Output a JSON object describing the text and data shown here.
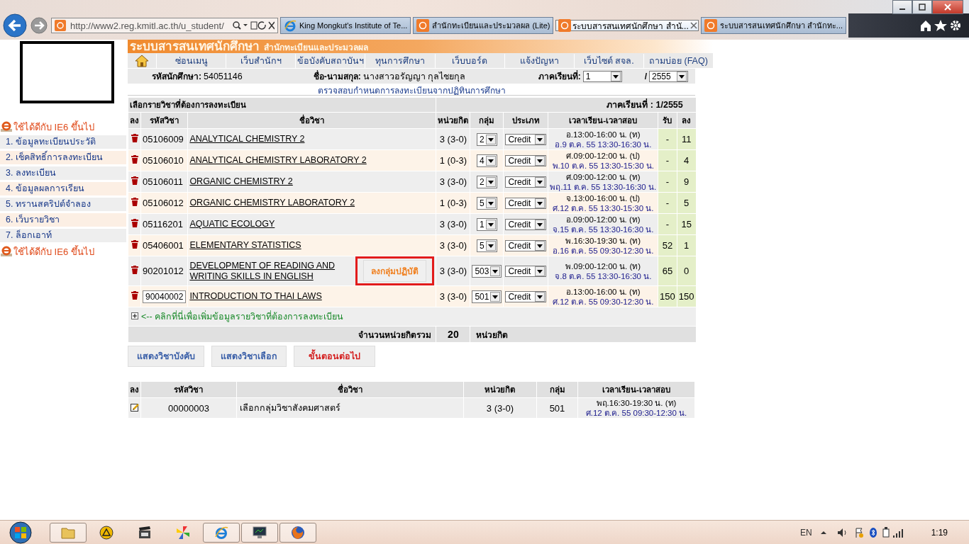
{
  "browser": {
    "url": "http://www2.reg.kmitl.ac.th/u_student/",
    "tabs": [
      {
        "title": "King Mongkut's Institute of Te...",
        "kind": "ie",
        "selected": false
      },
      {
        "title": "สำนักทะเบียนและประมวลผล (Lite)",
        "kind": "reg",
        "selected": false
      },
      {
        "title": "ระบบสารสนเทศนักศึกษา สำนั...",
        "kind": "reg",
        "selected": true
      },
      {
        "title": "ระบบสารสนเทศนักศึกษา สำนักทะ...",
        "kind": "reg",
        "selected": false
      }
    ]
  },
  "sidebar": {
    "note_top": "ใช้ได้ดีกับ IE6 ขึ้นไป",
    "items": [
      "1. ข้อมูลทะเบียนประวัติ",
      "2. เช็คสิทธิ์การลงทะเบียน",
      "3. ลงทะเบียน",
      "4. ข้อมูลผลการเรียน",
      "5. ทรานสคริปต์จำลอง",
      "6. เว็บรายวิชา",
      "7. ล็อกเอาท์"
    ],
    "note_bottom": "ใช้ได้ดีกับ IE6 ขึ้นไป"
  },
  "header": {
    "title": "ระบบสารสนเทศนักศึกษา",
    "subtitle": "สำนักทะเบียนและประมวลผล"
  },
  "nav": [
    "ซ่อนเมนู",
    "เว็บสำนักฯ",
    "ข้อบังคับสถาบันฯ",
    "ทุนการศึกษา",
    "เว็บบอร์ด",
    "แจ้งปัญหา",
    "เว็บไซต์ สจล.",
    "ถามบ่อย (FAQ)"
  ],
  "student": {
    "id_label": "รหัสนักศึกษา:",
    "id": "54051146",
    "name_label": "ชื่อ-นามสกุล:",
    "name": "นางสาวอรัญญา  กุลไชยกุล",
    "semester_label": "ภาคเรียนที่:",
    "semester": "1",
    "separator": "/",
    "year": "2555"
  },
  "check_link": "ตรวจสอบกำหนดการลงทะเบียนจากปฏิทินการศึกษา",
  "courses": {
    "caption": "เลือกรายวิชาที่ต้องการลงทะเบียน",
    "semester": "ภาคเรียนที่ : 1/2555",
    "columns": [
      "ลง",
      "รหัสวิชา",
      "ชื่อวิชา",
      "หน่วยกิต",
      "กลุ่ม",
      "ประเภท",
      "เวลาเรียน-เวลาสอบ",
      "รับ",
      "ลง"
    ],
    "rows": [
      {
        "code": "05106009",
        "kind": "text",
        "name": "ANALYTICAL CHEMISTRY 2",
        "credits": "3 (3-0)",
        "section": "2",
        "type": "Credit",
        "time": "อ.13:00-16:00 น. (ท)",
        "exam": "อ.9 ต.ค. 55 13:30-16:30 น.",
        "received": "-",
        "enrolled": "11"
      },
      {
        "code": "05106010",
        "kind": "text",
        "name": "ANALYTICAL CHEMISTRY LABORATORY 2",
        "credits": "1 (0-3)",
        "section": "4",
        "type": "Credit",
        "time": "ศ.09:00-12:00 น. (ป)",
        "exam": "พ.10 ต.ค. 55 13:30-15:30 น.",
        "received": "-",
        "enrolled": "4"
      },
      {
        "code": "05106011",
        "kind": "text",
        "name": "ORGANIC CHEMISTRY 2",
        "credits": "3 (3-0)",
        "section": "2",
        "type": "Credit",
        "time": "ศ.09:00-12:00 น. (ท)",
        "exam": "พฤ.11 ต.ค. 55 13:30-16:30 น.",
        "received": "-",
        "enrolled": "9"
      },
      {
        "code": "05106012",
        "kind": "text",
        "name": "ORGANIC CHEMISTRY LABORATORY 2",
        "credits": "1 (0-3)",
        "section": "5",
        "type": "Credit",
        "time": "จ.13:00-16:00 น. (ป)",
        "exam": "ศ.12 ต.ค. 55 13:30-15:30 น.",
        "received": "-",
        "enrolled": "5"
      },
      {
        "code": "05116201",
        "kind": "text",
        "name": "AQUATIC ECOLOGY",
        "credits": "3 (3-0)",
        "section": "1",
        "type": "Credit",
        "time": "อ.09:00-12:00 น. (ท)",
        "exam": "จ.15 ต.ค. 55 13:30-16:30 น.",
        "received": "-",
        "enrolled": "15"
      },
      {
        "code": "05406001",
        "kind": "text",
        "name": "ELEMENTARY STATISTICS",
        "credits": "3 (3-0)",
        "section": "5",
        "type": "Credit",
        "time": "พ.16:30-19:30 น. (ท)",
        "exam": "อ.16 ต.ค. 55 09:30-12:30 น.",
        "received": "52",
        "enrolled": "1"
      },
      {
        "code": "90201012",
        "kind": "text",
        "name": "DEVELOPMENT OF READING AND WRITING SKILLS IN ENGLISH",
        "credits": "3 (3-0)",
        "section": "503",
        "type": "Credit",
        "time": "พ.09:00-12:00 น. (ท)",
        "exam": "จ.8 ต.ค. 55 13:30-16:30 น.",
        "received": "65",
        "enrolled": "0",
        "action": "ลงกลุ่มปฏิบัติ",
        "highlighted": true
      },
      {
        "code": "90040002",
        "kind": "input",
        "name": "INTRODUCTION TO THAI LAWS",
        "credits": "3 (3-0)",
        "section": "501",
        "type": "Credit",
        "time": "อ.13:00-16:00 น. (ท)",
        "exam": "ศ.12 ต.ค. 55 09:30-12:30 น.",
        "received": "150",
        "enrolled": "150"
      }
    ],
    "add_link": "<-- คลิกที่นี่เพื่อเพิ่มข้อมูลรายวิชาที่ต้องการลงทะเบียน",
    "total_label": "จำนวนหน่วยกิตรวม",
    "total": "20",
    "total_unit": "หน่วยกิต"
  },
  "buttons": [
    {
      "label": "แสดงวิชาบังคับ",
      "kind": "normal"
    },
    {
      "label": "แสดงวิชาเลือก",
      "kind": "normal"
    },
    {
      "label": "ขั้นตอนต่อไป",
      "kind": "next"
    }
  ],
  "pending": {
    "columns": [
      "ลง",
      "รหัสวิชา",
      "ชื่อวิชา",
      "หน่วยกิต",
      "กลุ่ม",
      "เวลาเรียน-เวลาสอบ"
    ],
    "rows": [
      {
        "code": "00000003",
        "name": "เลือกกลุ่มวิชาสังคมศาสตร์",
        "credits": "3 (3-0)",
        "section": "501",
        "time": "พฤ.16:30-19:30 น. (ท)",
        "exam": "ศ.12 ต.ค. 55 09:30-12:30 น."
      }
    ]
  },
  "taskbar": {
    "apps": [
      {
        "kind": "folder",
        "running": true
      },
      {
        "kind": "cone",
        "running": false
      },
      {
        "kind": "clapper",
        "running": false
      },
      {
        "kind": "pinwheel",
        "running": false
      },
      {
        "kind": "ie",
        "running": true
      },
      {
        "kind": "monitor",
        "running": true
      },
      {
        "kind": "firefox",
        "running": true
      }
    ],
    "language": "EN",
    "clock": "1:19"
  }
}
